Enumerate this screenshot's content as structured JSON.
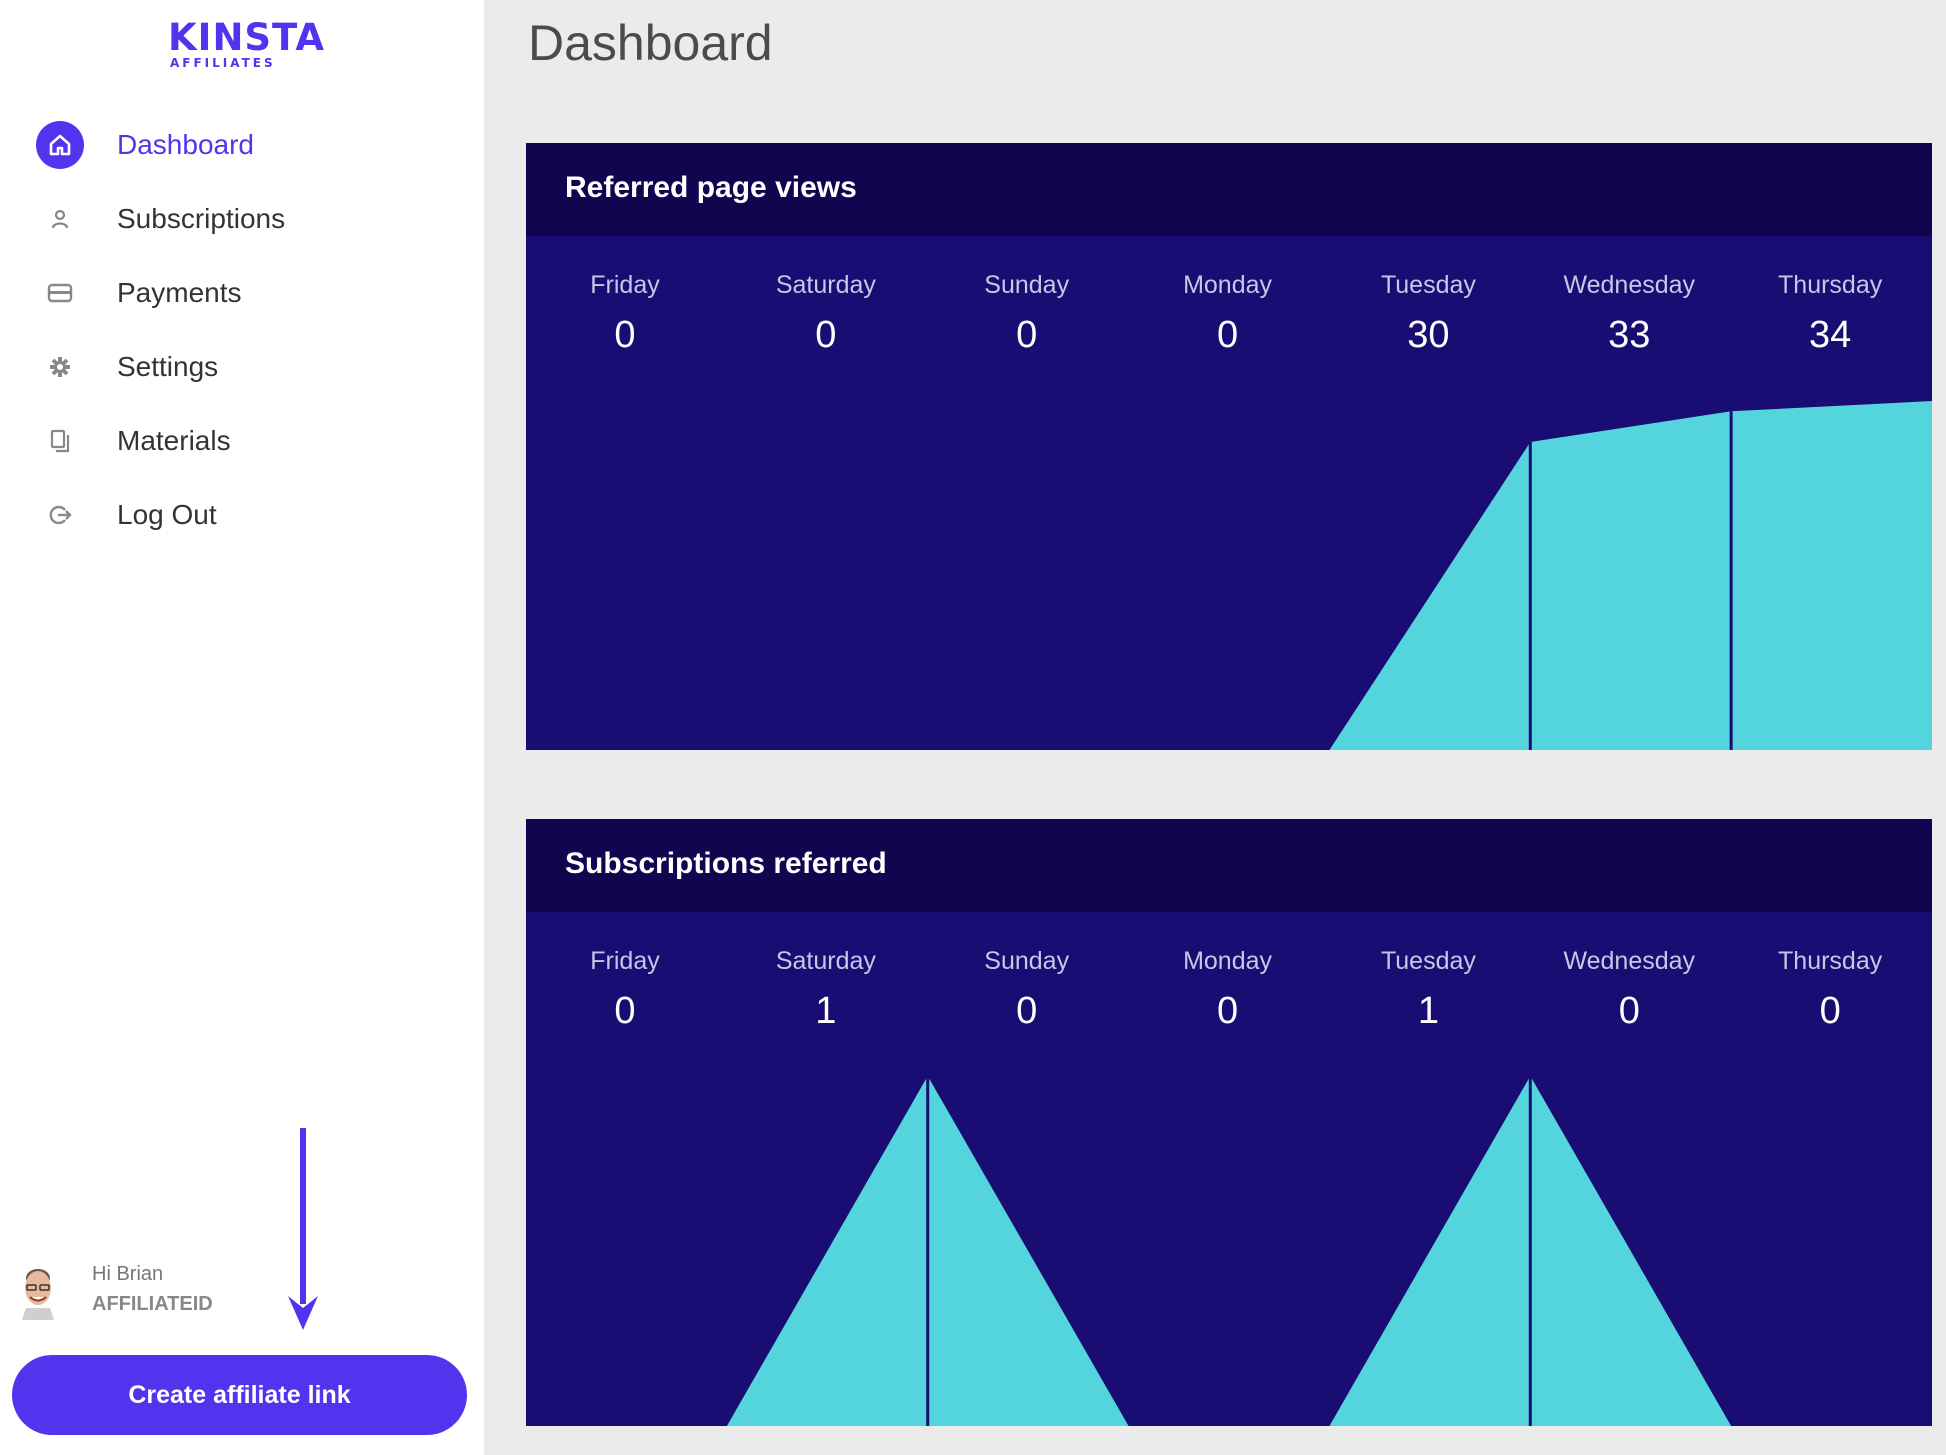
{
  "brand": {
    "logo_text": "KINSTA",
    "logo_sub": "AFFILIATES",
    "accent": "#5333ed"
  },
  "sidebar": {
    "items": [
      {
        "label": "Dashboard",
        "icon": "home-icon",
        "active": true
      },
      {
        "label": "Subscriptions",
        "icon": "user-icon"
      },
      {
        "label": "Payments",
        "icon": "credit-card-icon"
      },
      {
        "label": "Settings",
        "icon": "gear-icon"
      },
      {
        "label": "Materials",
        "icon": "documents-icon"
      },
      {
        "label": "Log Out",
        "icon": "logout-icon"
      }
    ]
  },
  "user": {
    "greeting": "Hi Brian",
    "affiliate_id": "AFFILIATEID"
  },
  "cta": {
    "label": "Create affiliate link"
  },
  "page": {
    "title": "Dashboard"
  },
  "colors": {
    "panel_bg": "#190c72",
    "header_bg": "#100650",
    "area": "#54d4dc"
  },
  "chart_data": [
    {
      "type": "area",
      "title": "Referred page views",
      "categories": [
        "Friday",
        "Saturday",
        "Sunday",
        "Monday",
        "Tuesday",
        "Wednesday",
        "Thursday"
      ],
      "values": [
        0,
        0,
        0,
        0,
        30,
        33,
        34
      ],
      "ylim": [
        0,
        34
      ]
    },
    {
      "type": "area",
      "title": "Subscriptions referred",
      "categories": [
        "Friday",
        "Saturday",
        "Sunday",
        "Monday",
        "Tuesday",
        "Wednesday",
        "Thursday"
      ],
      "values": [
        0,
        1,
        0,
        0,
        1,
        0,
        0
      ],
      "ylim": [
        0,
        1
      ]
    }
  ]
}
